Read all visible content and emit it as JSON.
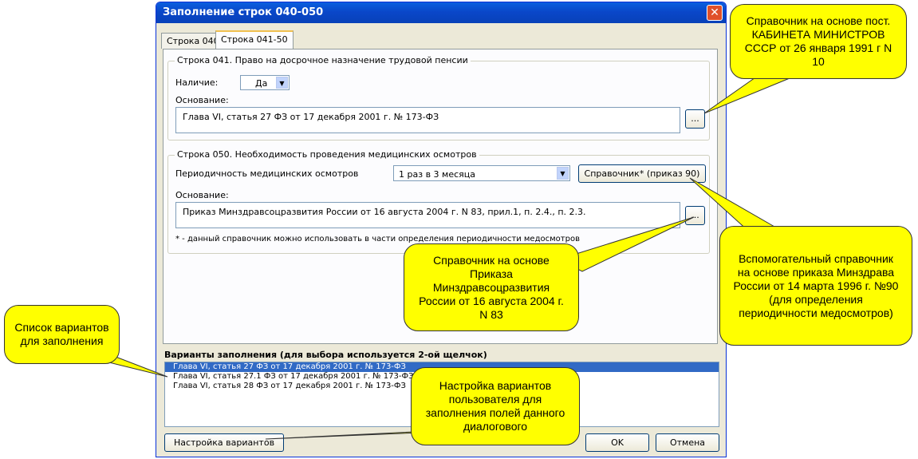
{
  "window": {
    "title": "Заполнение строк 040-050",
    "close_glyph": "✕"
  },
  "tabs": [
    {
      "label": "Строка 040"
    },
    {
      "label": "Строка 041-50"
    }
  ],
  "group041": {
    "title": "Строка 041. Право на досрочное назначение трудовой пенсии",
    "presence_label": "Наличие:",
    "presence_value": "Да",
    "basis_label": "Основание:",
    "basis_value": "Глава VI, статья 27 ФЗ от 17 декабря 2001 г. № 173-ФЗ",
    "browse_label": "..."
  },
  "group050": {
    "title": "Строка 050. Необходимость проведения медицинских осмотров",
    "period_label": "Периодичность медицинских осмотров",
    "period_value": "1 раз в 3 месяца",
    "reference_button": "Справочник* (приказ 90)",
    "basis_label": "Основание:",
    "basis_value": "Приказ Минздравсоцразвития России от 16 августа 2004 г. N 83, прил.1, п. 2.4., п. 2.3.",
    "browse_label": "...",
    "footnote": "* - данный справочник можно использовать в части  определения периодичности медосмотров"
  },
  "variants": {
    "heading": "Варианты заполнения (для выбора используется 2-ой щелчок)",
    "items": [
      "Глава VI, статья 27 ФЗ от 17 декабря 2001 г. № 173-ФЗ",
      "Глава VI, статья 27.1 ФЗ от 17 декабря 2001 г. № 173-ФЗ",
      "Глава VI, статья 28 ФЗ от 17 декабря 2001 г. № 173-ФЗ"
    ]
  },
  "buttons": {
    "settings": "Настройка вариантов",
    "ok": "OK",
    "cancel": "Отмена"
  },
  "callouts": {
    "cabinet": "Справочник на основе пост. КАБИНЕТА МИНИСТРОВ СССР от 26 января 1991 г N 10",
    "order90": "Вспомогательный справочник на основе приказа Минздрава России от 14 марта 1996 г. №90 (для определения периодичности медосмотров)",
    "minzdrav": "Справочник на основе Приказа Минздравсоцразвития России от 16 августа 2004 г. N 83",
    "variants_list": "Список вариантов для заполнения",
    "settings": "Настройка вариантов пользователя для заполнения полей данного диалогового"
  },
  "colors": {
    "callout": "#ffff00",
    "titlebar": "#0a47c9",
    "selection": "#316ac5"
  },
  "icons": {
    "close": "close-icon",
    "dropdown": "chevron-down-icon"
  }
}
